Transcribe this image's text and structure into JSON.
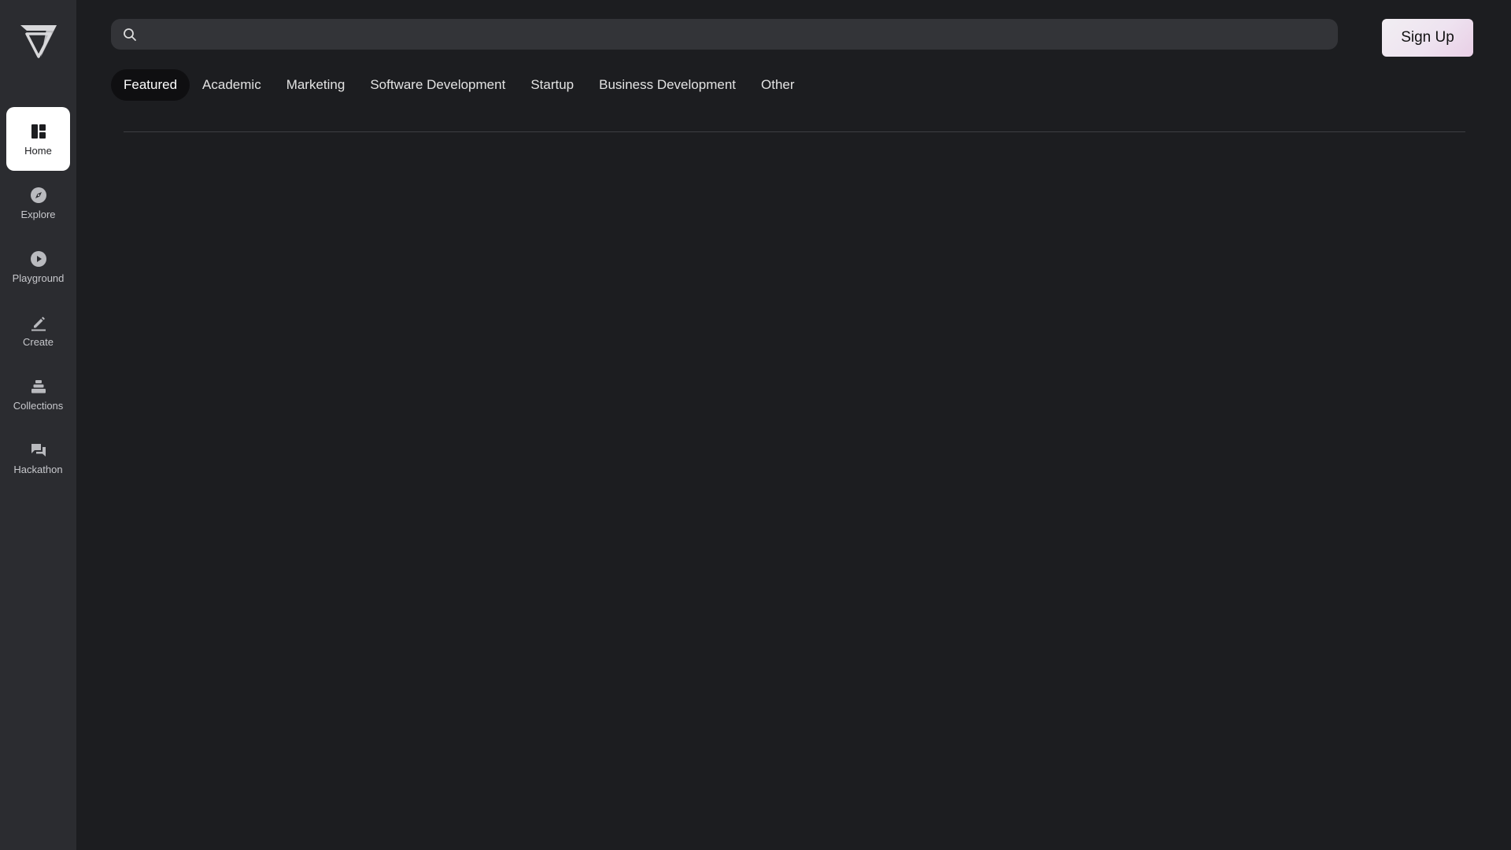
{
  "sidebar": {
    "items": [
      {
        "label": "Home",
        "icon": "dashboard-icon",
        "active": true
      },
      {
        "label": "Explore",
        "icon": "compass-icon",
        "active": false
      },
      {
        "label": "Playground",
        "icon": "play-circle-icon",
        "active": false
      },
      {
        "label": "Create",
        "icon": "pencil-icon",
        "active": false
      },
      {
        "label": "Collections",
        "icon": "stack-icon",
        "active": false
      },
      {
        "label": "Hackathon",
        "icon": "chat-bubbles-icon",
        "active": false
      }
    ]
  },
  "search": {
    "placeholder": "",
    "value": ""
  },
  "header": {
    "signup_label": "Sign Up"
  },
  "tabs": [
    {
      "label": "Featured",
      "active": true
    },
    {
      "label": "Academic",
      "active": false
    },
    {
      "label": "Marketing",
      "active": false
    },
    {
      "label": "Software Development",
      "active": false
    },
    {
      "label": "Startup",
      "active": false
    },
    {
      "label": "Business Development",
      "active": false
    },
    {
      "label": "Other",
      "active": false
    }
  ],
  "colors": {
    "background": "#1c1d20",
    "sidebar": "#2b2c30",
    "active_nav": "#ffffff",
    "active_tab": "#0f0f11"
  }
}
